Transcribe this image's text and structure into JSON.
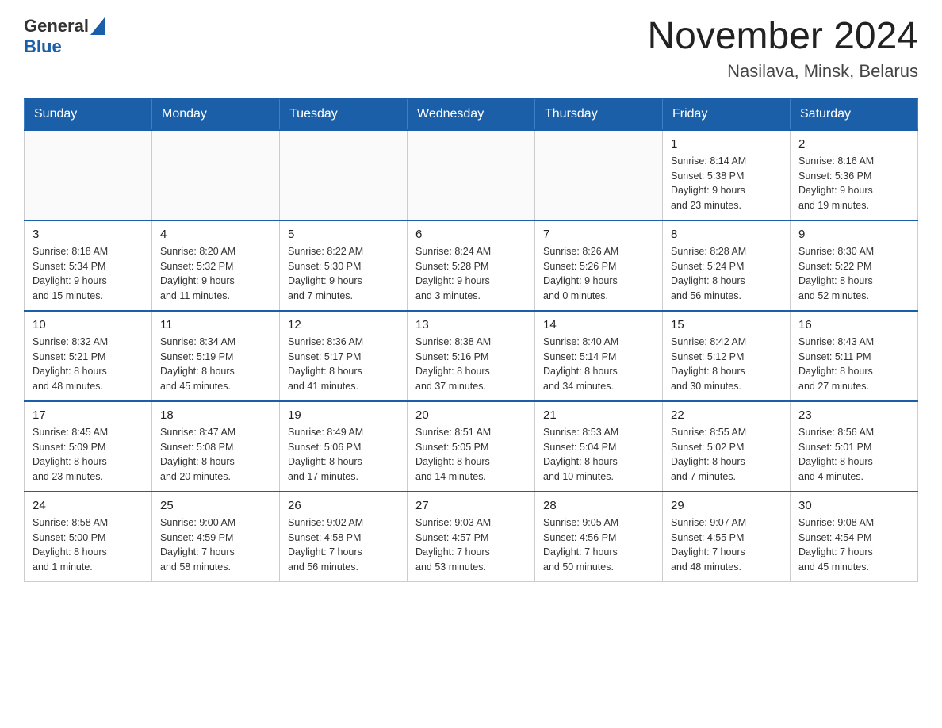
{
  "header": {
    "title": "November 2024",
    "subtitle": "Nasilava, Minsk, Belarus",
    "logo_general": "General",
    "logo_blue": "Blue"
  },
  "days_of_week": [
    "Sunday",
    "Monday",
    "Tuesday",
    "Wednesday",
    "Thursday",
    "Friday",
    "Saturday"
  ],
  "weeks": [
    {
      "days": [
        {
          "num": "",
          "info": ""
        },
        {
          "num": "",
          "info": ""
        },
        {
          "num": "",
          "info": ""
        },
        {
          "num": "",
          "info": ""
        },
        {
          "num": "",
          "info": ""
        },
        {
          "num": "1",
          "info": "Sunrise: 8:14 AM\nSunset: 5:38 PM\nDaylight: 9 hours\nand 23 minutes."
        },
        {
          "num": "2",
          "info": "Sunrise: 8:16 AM\nSunset: 5:36 PM\nDaylight: 9 hours\nand 19 minutes."
        }
      ]
    },
    {
      "days": [
        {
          "num": "3",
          "info": "Sunrise: 8:18 AM\nSunset: 5:34 PM\nDaylight: 9 hours\nand 15 minutes."
        },
        {
          "num": "4",
          "info": "Sunrise: 8:20 AM\nSunset: 5:32 PM\nDaylight: 9 hours\nand 11 minutes."
        },
        {
          "num": "5",
          "info": "Sunrise: 8:22 AM\nSunset: 5:30 PM\nDaylight: 9 hours\nand 7 minutes."
        },
        {
          "num": "6",
          "info": "Sunrise: 8:24 AM\nSunset: 5:28 PM\nDaylight: 9 hours\nand 3 minutes."
        },
        {
          "num": "7",
          "info": "Sunrise: 8:26 AM\nSunset: 5:26 PM\nDaylight: 9 hours\nand 0 minutes."
        },
        {
          "num": "8",
          "info": "Sunrise: 8:28 AM\nSunset: 5:24 PM\nDaylight: 8 hours\nand 56 minutes."
        },
        {
          "num": "9",
          "info": "Sunrise: 8:30 AM\nSunset: 5:22 PM\nDaylight: 8 hours\nand 52 minutes."
        }
      ]
    },
    {
      "days": [
        {
          "num": "10",
          "info": "Sunrise: 8:32 AM\nSunset: 5:21 PM\nDaylight: 8 hours\nand 48 minutes."
        },
        {
          "num": "11",
          "info": "Sunrise: 8:34 AM\nSunset: 5:19 PM\nDaylight: 8 hours\nand 45 minutes."
        },
        {
          "num": "12",
          "info": "Sunrise: 8:36 AM\nSunset: 5:17 PM\nDaylight: 8 hours\nand 41 minutes."
        },
        {
          "num": "13",
          "info": "Sunrise: 8:38 AM\nSunset: 5:16 PM\nDaylight: 8 hours\nand 37 minutes."
        },
        {
          "num": "14",
          "info": "Sunrise: 8:40 AM\nSunset: 5:14 PM\nDaylight: 8 hours\nand 34 minutes."
        },
        {
          "num": "15",
          "info": "Sunrise: 8:42 AM\nSunset: 5:12 PM\nDaylight: 8 hours\nand 30 minutes."
        },
        {
          "num": "16",
          "info": "Sunrise: 8:43 AM\nSunset: 5:11 PM\nDaylight: 8 hours\nand 27 minutes."
        }
      ]
    },
    {
      "days": [
        {
          "num": "17",
          "info": "Sunrise: 8:45 AM\nSunset: 5:09 PM\nDaylight: 8 hours\nand 23 minutes."
        },
        {
          "num": "18",
          "info": "Sunrise: 8:47 AM\nSunset: 5:08 PM\nDaylight: 8 hours\nand 20 minutes."
        },
        {
          "num": "19",
          "info": "Sunrise: 8:49 AM\nSunset: 5:06 PM\nDaylight: 8 hours\nand 17 minutes."
        },
        {
          "num": "20",
          "info": "Sunrise: 8:51 AM\nSunset: 5:05 PM\nDaylight: 8 hours\nand 14 minutes."
        },
        {
          "num": "21",
          "info": "Sunrise: 8:53 AM\nSunset: 5:04 PM\nDaylight: 8 hours\nand 10 minutes."
        },
        {
          "num": "22",
          "info": "Sunrise: 8:55 AM\nSunset: 5:02 PM\nDaylight: 8 hours\nand 7 minutes."
        },
        {
          "num": "23",
          "info": "Sunrise: 8:56 AM\nSunset: 5:01 PM\nDaylight: 8 hours\nand 4 minutes."
        }
      ]
    },
    {
      "days": [
        {
          "num": "24",
          "info": "Sunrise: 8:58 AM\nSunset: 5:00 PM\nDaylight: 8 hours\nand 1 minute."
        },
        {
          "num": "25",
          "info": "Sunrise: 9:00 AM\nSunset: 4:59 PM\nDaylight: 7 hours\nand 58 minutes."
        },
        {
          "num": "26",
          "info": "Sunrise: 9:02 AM\nSunset: 4:58 PM\nDaylight: 7 hours\nand 56 minutes."
        },
        {
          "num": "27",
          "info": "Sunrise: 9:03 AM\nSunset: 4:57 PM\nDaylight: 7 hours\nand 53 minutes."
        },
        {
          "num": "28",
          "info": "Sunrise: 9:05 AM\nSunset: 4:56 PM\nDaylight: 7 hours\nand 50 minutes."
        },
        {
          "num": "29",
          "info": "Sunrise: 9:07 AM\nSunset: 4:55 PM\nDaylight: 7 hours\nand 48 minutes."
        },
        {
          "num": "30",
          "info": "Sunrise: 9:08 AM\nSunset: 4:54 PM\nDaylight: 7 hours\nand 45 minutes."
        }
      ]
    }
  ]
}
